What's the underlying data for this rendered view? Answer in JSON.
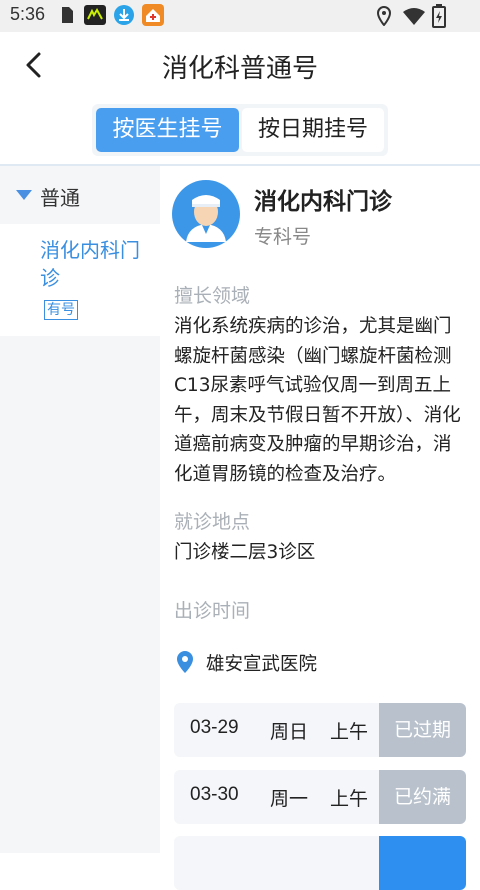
{
  "status_bar": {
    "time": "5:36"
  },
  "header": {
    "title": "消化科普通号",
    "back_icon": "chevron-left-icon"
  },
  "tabs": [
    {
      "label": "按医生挂号",
      "active": true
    },
    {
      "label": "按日期挂号",
      "active": false
    }
  ],
  "sidebar": {
    "category": "普通",
    "items": [
      {
        "name": "消化内科门诊",
        "badge": "有号"
      }
    ]
  },
  "doctor": {
    "name": "消化内科门诊",
    "type": "专科号",
    "expertise_label": "擅长领域",
    "expertise": "消化系统疾病的诊治，尤其是幽门螺旋杆菌感染（幽门螺旋杆菌检测C13尿素呼气试验仅周一到周五上午，周末及节假日暂不开放）、消化道癌前病变及肿瘤的早期诊治，消化道胃肠镜的检查及治疗。",
    "location_label": "就诊地点",
    "location": "门诊楼二层3诊区",
    "schedule_label": "出诊时间",
    "hospital": "雄安宣武医院"
  },
  "schedule": [
    {
      "date": "03-29",
      "weekday": "周日",
      "period": "上午",
      "status": "已过期"
    },
    {
      "date": "03-30",
      "weekday": "周一",
      "period": "上午",
      "status": "已约满"
    },
    {
      "date": "",
      "weekday": "",
      "period": "",
      "status": ""
    }
  ],
  "colors": {
    "accent": "#4a9ef0",
    "disabled": "#b9c2cc",
    "link": "#3a8fe0"
  }
}
